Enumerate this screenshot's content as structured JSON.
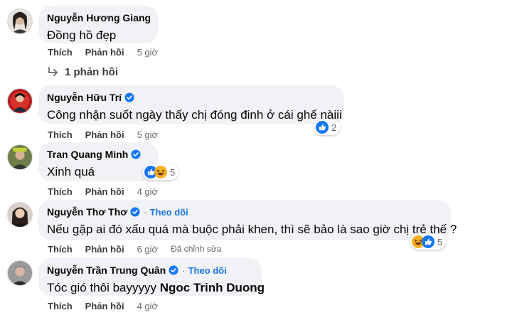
{
  "comments": [
    {
      "name": "Nguyễn Hương Giang",
      "verified": false,
      "text": "Đồng hồ đẹp",
      "like_label": "Thích",
      "reply_label": "Phản hồi",
      "time": "5 giờ",
      "replies_label": "1 phản hồi"
    },
    {
      "name": "Nguyễn Hữu Trí",
      "verified": true,
      "text": "Công nhận suốt ngày thấy chị đóng đinh ở cái ghế nàiii",
      "like_label": "Thích",
      "reply_label": "Phản hồi",
      "time": "5 giờ",
      "reactions": {
        "icons": [
          "like-icon"
        ],
        "count": "2"
      }
    },
    {
      "name": "Tran Quang Minh",
      "verified": true,
      "text": "Xinh quá",
      "like_label": "Thích",
      "reply_label": "Phản hồi",
      "time": "4 giờ",
      "reactions": {
        "icons": [
          "like-icon",
          "haha-icon"
        ],
        "count": "5"
      }
    },
    {
      "name": "Nguyễn Thơ Thơ",
      "verified": true,
      "follow_label": "Theo dõi",
      "text": "Nếu gặp ai đó xấu quá mà buộc phải khen, thì sẽ bảo là sao giờ chị trẻ thế ?",
      "like_label": "Thích",
      "reply_label": "Phản hồi",
      "time": "6 giờ",
      "edited_label": "Đã chỉnh sửa",
      "reactions": {
        "icons": [
          "haha-icon",
          "like-icon"
        ],
        "count": "5"
      }
    },
    {
      "name": "Nguyễn Trần Trung Quân",
      "verified": true,
      "follow_label": "Theo dõi",
      "text": "Tóc gió thôi bayyyyy",
      "mention": "Ngoc Trinh Duong",
      "like_label": "Thích",
      "reply_label": "Phản hồi",
      "time": "4 giờ"
    }
  ],
  "colors": {
    "bubble": "#f0f2f5",
    "link_blue": "#1b74e4",
    "verified_blue": "#1877f2",
    "secondary_text": "#65676b"
  }
}
